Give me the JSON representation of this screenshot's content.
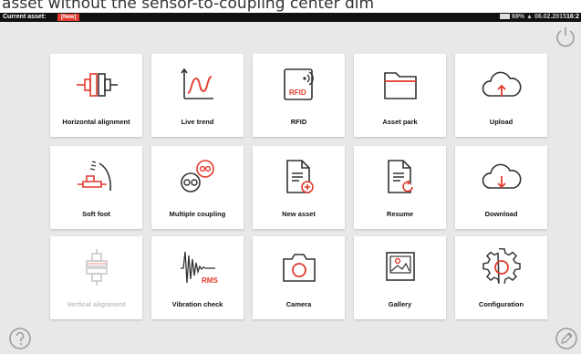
{
  "caption": "asset without the sensor-to-coupling center dim",
  "statusbar": {
    "asset_label": "Current asset:",
    "asset_value": "[New]",
    "battery": "69%",
    "date": "06.02.2015",
    "time": "16:2"
  },
  "tiles": [
    {
      "label": "Horizontal alignment",
      "icon": "horizontal-alignment-icon",
      "enabled": true
    },
    {
      "label": "Live trend",
      "icon": "live-trend-icon",
      "enabled": true
    },
    {
      "label": "RFID",
      "icon": "rfid-icon",
      "enabled": true
    },
    {
      "label": "Asset park",
      "icon": "folder-icon",
      "enabled": true
    },
    {
      "label": "Upload",
      "icon": "cloud-upload-icon",
      "enabled": true
    },
    {
      "label": "Soft foot",
      "icon": "soft-foot-icon",
      "enabled": true
    },
    {
      "label": "Multiple coupling",
      "icon": "multiple-coupling-icon",
      "enabled": true
    },
    {
      "label": "New asset",
      "icon": "new-document-icon",
      "enabled": true
    },
    {
      "label": "Resume",
      "icon": "resume-document-icon",
      "enabled": true
    },
    {
      "label": "Download",
      "icon": "cloud-download-icon",
      "enabled": true
    },
    {
      "label": "Vertical alignment",
      "icon": "vertical-alignment-icon",
      "enabled": false
    },
    {
      "label": "Vibration check",
      "icon": "vibration-icon",
      "enabled": true
    },
    {
      "label": "Camera",
      "icon": "camera-icon",
      "enabled": true
    },
    {
      "label": "Gallery",
      "icon": "gallery-icon",
      "enabled": true
    },
    {
      "label": "Configuration",
      "icon": "gear-icon",
      "enabled": true
    }
  ],
  "icon_texts": {
    "rfid": "RFID",
    "rms": "RMS"
  },
  "colors": {
    "accent": "#e23a2e",
    "icon_stroke": "#333333",
    "disabled": "#c8c8c8"
  }
}
